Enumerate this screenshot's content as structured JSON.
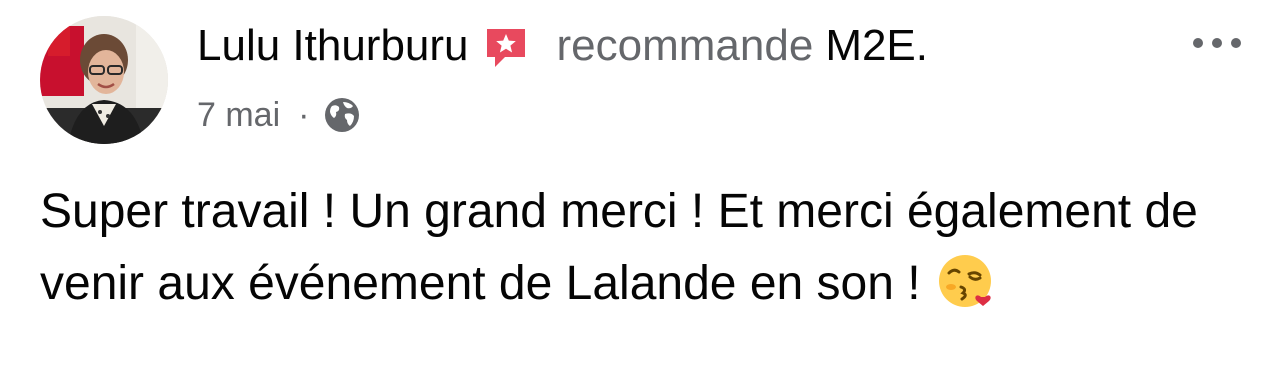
{
  "post": {
    "author": "Lulu Ithurburu",
    "verb": "recommande",
    "page": "M2E",
    "page_suffix": ".",
    "date": "7 mai",
    "meta_separator": "·",
    "privacy_icon": "globe-icon",
    "recommend_icon": "recommend-star-icon",
    "more_icon": "more-options-icon",
    "text": "Super travail ! Un grand merci ! Et merci également de venir aux événement de Lalande en son !",
    "emoji": "face-blowing-kiss-emoji"
  },
  "colors": {
    "text_primary": "#050505",
    "text_secondary": "#65676b",
    "recommend_red": "#e8495e",
    "background": "#ffffff"
  }
}
